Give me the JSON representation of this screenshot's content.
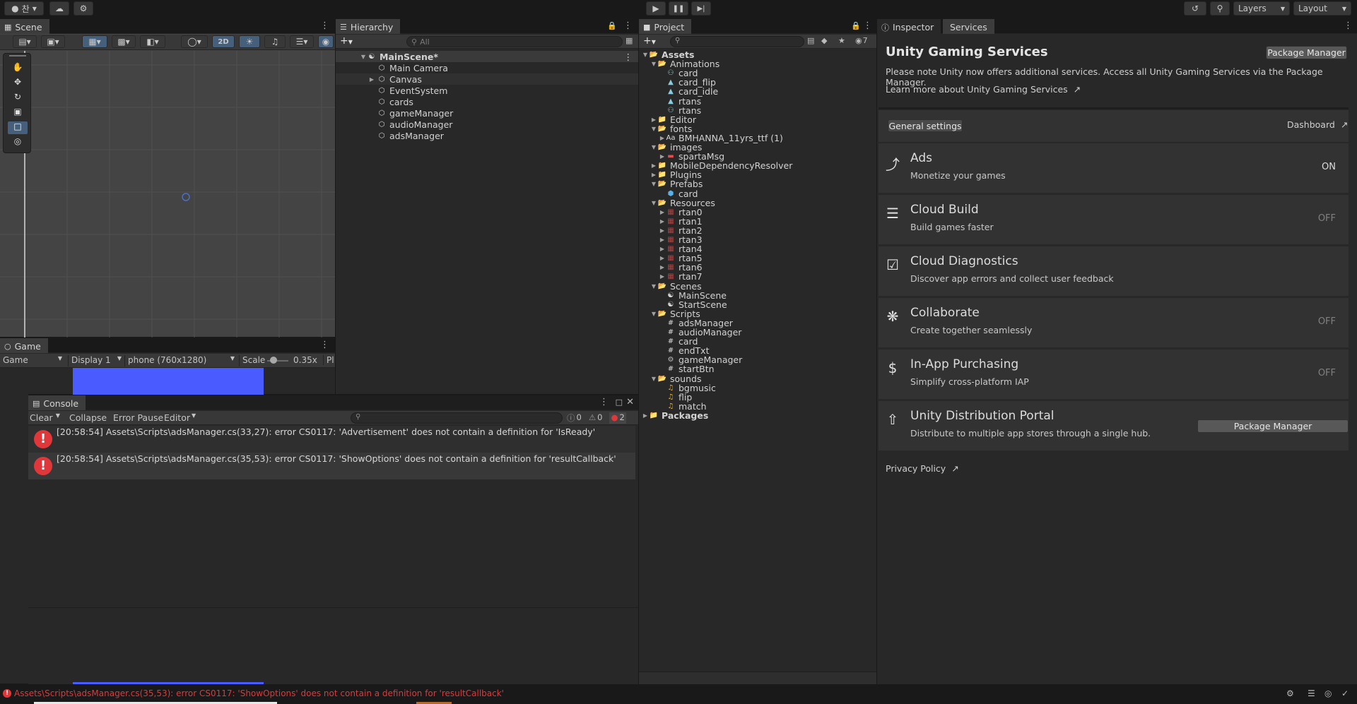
{
  "toolbar": {
    "account_label": "찬",
    "layers_label": "Layers",
    "layout_label": "Layout"
  },
  "scene": {
    "tab": "Scene",
    "mode_2d": "2D"
  },
  "game": {
    "tab": "Game",
    "view_select": "Game",
    "display_select": "Display 1",
    "resolution_select": "phone (760x1280)",
    "scale_label": "Scale",
    "scale_value": "0.35x",
    "play_focused": "Pl"
  },
  "hierarchy": {
    "tab": "Hierarchy",
    "search_placeholder": "All",
    "scene_name": "MainScene*",
    "items": [
      "Main Camera",
      "Canvas",
      "EventSystem",
      "cards",
      "gameManager",
      "audioManager",
      "adsManager"
    ]
  },
  "project": {
    "tab": "Project",
    "hidden_count": "7",
    "rows": [
      {
        "label": "Assets",
        "indent": 0,
        "arrow": "open",
        "icon": "folder-open",
        "bold": true
      },
      {
        "label": "Animations",
        "indent": 1,
        "arrow": "open",
        "icon": "folder-open"
      },
      {
        "label": "card",
        "indent": 2,
        "arrow": "",
        "icon": "animator-controller"
      },
      {
        "label": "card_flip",
        "indent": 2,
        "arrow": "",
        "icon": "animation-clip"
      },
      {
        "label": "card_idle",
        "indent": 2,
        "arrow": "",
        "icon": "animation-clip"
      },
      {
        "label": "rtans",
        "indent": 2,
        "arrow": "",
        "icon": "animation-clip"
      },
      {
        "label": "rtans",
        "indent": 2,
        "arrow": "",
        "icon": "animator-controller"
      },
      {
        "label": "Editor",
        "indent": 1,
        "arrow": "closed",
        "icon": "folder"
      },
      {
        "label": "fonts",
        "indent": 1,
        "arrow": "open",
        "icon": "folder-open"
      },
      {
        "label": "BMHANNA_11yrs_ttf (1)",
        "indent": 2,
        "arrow": "closed",
        "icon": "font"
      },
      {
        "label": "images",
        "indent": 1,
        "arrow": "open",
        "icon": "folder-open"
      },
      {
        "label": "spartaMsg",
        "indent": 2,
        "arrow": "closed",
        "icon": "sprite"
      },
      {
        "label": "MobileDependencyResolver",
        "indent": 1,
        "arrow": "closed",
        "icon": "folder"
      },
      {
        "label": "Plugins",
        "indent": 1,
        "arrow": "closed",
        "icon": "folder"
      },
      {
        "label": "Prefabs",
        "indent": 1,
        "arrow": "open",
        "icon": "folder-open"
      },
      {
        "label": "card",
        "indent": 2,
        "arrow": "",
        "icon": "prefab"
      },
      {
        "label": "Resources",
        "indent": 1,
        "arrow": "open",
        "icon": "folder-open"
      },
      {
        "label": "rtan0",
        "indent": 2,
        "arrow": "closed",
        "icon": "sprite-char"
      },
      {
        "label": "rtan1",
        "indent": 2,
        "arrow": "closed",
        "icon": "sprite-char"
      },
      {
        "label": "rtan2",
        "indent": 2,
        "arrow": "closed",
        "icon": "sprite-char"
      },
      {
        "label": "rtan3",
        "indent": 2,
        "arrow": "closed",
        "icon": "sprite-char"
      },
      {
        "label": "rtan4",
        "indent": 2,
        "arrow": "closed",
        "icon": "sprite-char"
      },
      {
        "label": "rtan5",
        "indent": 2,
        "arrow": "closed",
        "icon": "sprite-char"
      },
      {
        "label": "rtan6",
        "indent": 2,
        "arrow": "closed",
        "icon": "sprite-char"
      },
      {
        "label": "rtan7",
        "indent": 2,
        "arrow": "closed",
        "icon": "sprite-char"
      },
      {
        "label": "Scenes",
        "indent": 1,
        "arrow": "open",
        "icon": "folder-open"
      },
      {
        "label": "MainScene",
        "indent": 2,
        "arrow": "",
        "icon": "scene"
      },
      {
        "label": "StartScene",
        "indent": 2,
        "arrow": "",
        "icon": "scene"
      },
      {
        "label": "Scripts",
        "indent": 1,
        "arrow": "open",
        "icon": "folder-open"
      },
      {
        "label": "adsManager",
        "indent": 2,
        "arrow": "",
        "icon": "script"
      },
      {
        "label": "audioManager",
        "indent": 2,
        "arrow": "",
        "icon": "script"
      },
      {
        "label": "card",
        "indent": 2,
        "arrow": "",
        "icon": "script"
      },
      {
        "label": "endTxt",
        "indent": 2,
        "arrow": "",
        "icon": "script"
      },
      {
        "label": "gameManager",
        "indent": 2,
        "arrow": "",
        "icon": "gear-script"
      },
      {
        "label": "startBtn",
        "indent": 2,
        "arrow": "",
        "icon": "script"
      },
      {
        "label": "sounds",
        "indent": 1,
        "arrow": "open",
        "icon": "folder-open"
      },
      {
        "label": "bgmusic",
        "indent": 2,
        "arrow": "",
        "icon": "audio"
      },
      {
        "label": "flip",
        "indent": 2,
        "arrow": "",
        "icon": "audio"
      },
      {
        "label": "match",
        "indent": 2,
        "arrow": "",
        "icon": "audio"
      },
      {
        "label": "Packages",
        "indent": 0,
        "arrow": "closed",
        "icon": "folder",
        "bold": true
      }
    ]
  },
  "inspector": {
    "tab_inspector": "Inspector",
    "tab_services": "Services"
  },
  "services": {
    "title": "Unity Gaming Services",
    "package_manager": "Package Manager",
    "note": "Please note Unity now offers additional services. Access all Unity Gaming Services via the Package Manager.",
    "learn_more": "Learn more about Unity Gaming Services",
    "general_settings": "General settings",
    "dashboard": "Dashboard",
    "items": [
      {
        "title": "Ads",
        "desc": "Monetize your games",
        "state": "ON",
        "icon": "ads-icon"
      },
      {
        "title": "Cloud Build",
        "desc": "Build games faster",
        "state": "OFF",
        "icon": "cloud-build-icon"
      },
      {
        "title": "Cloud Diagnostics",
        "desc": "Discover app errors and collect user feedback",
        "state": "",
        "icon": "cloud-diagnostics-icon"
      },
      {
        "title": "Collaborate",
        "desc": "Create together seamlessly",
        "state": "OFF",
        "icon": "collaborate-icon"
      },
      {
        "title": "In-App Purchasing",
        "desc": "Simplify cross-platform IAP",
        "state": "OFF",
        "icon": "dollar-icon"
      },
      {
        "title": "Unity Distribution Portal",
        "desc": "Distribute to multiple app stores through a single hub.",
        "state": "",
        "icon": "distribution-icon"
      }
    ],
    "udp_button": "Package Manager",
    "privacy": "Privacy Policy"
  },
  "console": {
    "tab": "Console",
    "clear": "Clear",
    "collapse": "Collapse",
    "error_pause": "Error Pause",
    "editor": "Editor",
    "log_count": "0",
    "warn_count": "0",
    "error_count": "2",
    "messages": [
      "[20:58:54] Assets\\Scripts\\adsManager.cs(33,27): error CS0117: 'Advertisement' does not contain a definition for 'IsReady'",
      "[20:58:54] Assets\\Scripts\\adsManager.cs(35,53): error CS0117: 'ShowOptions' does not contain a definition for 'resultCallback'"
    ]
  },
  "statusbar": {
    "message": "Assets\\Scripts\\adsManager.cs(35,53): error CS0117: 'ShowOptions' does not contain a definition for 'resultCallback'"
  },
  "colors": {
    "accent": "#4a5bff",
    "error": "#e0383a",
    "panel": "#282828"
  }
}
